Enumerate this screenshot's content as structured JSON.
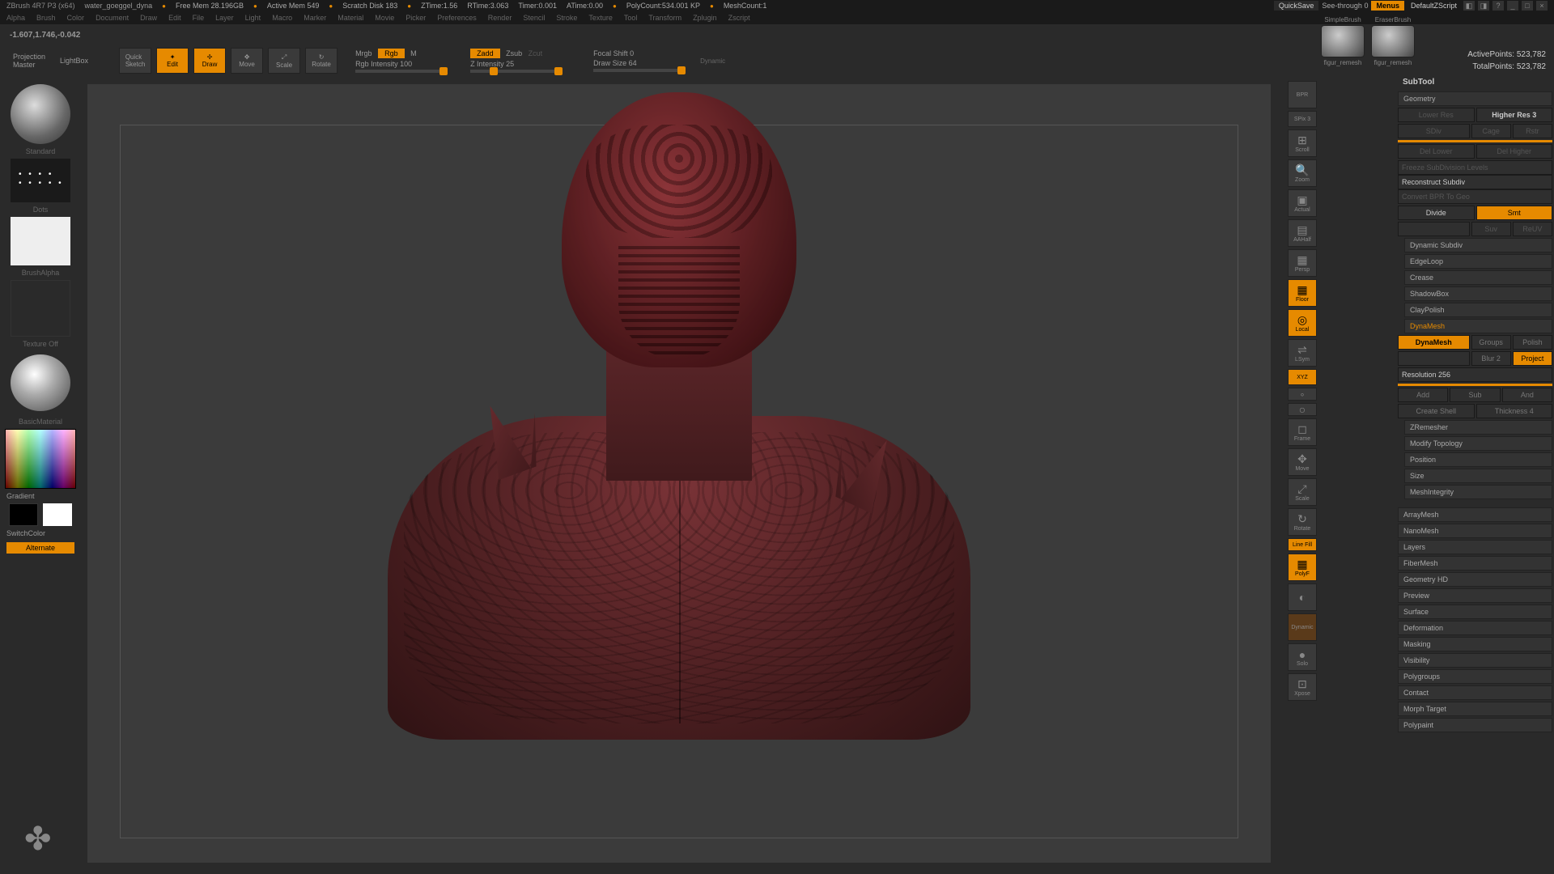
{
  "title": {
    "app": "ZBrush 4R7 P3 (x64)",
    "file": "water_goeggel_dyna",
    "free_mem": "Free Mem 28.196GB",
    "active_mem": "Active Mem 549",
    "scratch": "Scratch Disk 183",
    "ztime": "ZTime:1.56",
    "rtime": "RTime:3.063",
    "timer": "Timer:0.001",
    "atime": "ATime:0.00",
    "polycount": "PolyCount:534.001 KP",
    "meshcount": "MeshCount:1",
    "quicksave": "QuickSave",
    "seethrough": "See-through   0",
    "menus": "Menus",
    "dscript": "DefaultZScript"
  },
  "menubar": [
    "Alpha",
    "Brush",
    "Color",
    "Document",
    "Draw",
    "Edit",
    "File",
    "Layer",
    "Light",
    "Macro",
    "Marker",
    "Material",
    "Movie",
    "Picker",
    "Preferences",
    "Render",
    "Stencil",
    "Stroke",
    "Texture",
    "Tool",
    "Transform",
    "Zplugin",
    "Zscript"
  ],
  "coords": "-1.607,1.746,-0.042",
  "toolbar": {
    "projection": "Projection\nMaster",
    "lightbox": "LightBox",
    "quicksketch": "Quick\nSketch",
    "edit": "Edit",
    "draw": "Draw",
    "move": "Move",
    "scale": "Scale",
    "rotate": "Rotate",
    "mrgb": "Mrgb",
    "rgb": "Rgb",
    "m": "M",
    "rgb_intensity": "Rgb Intensity 100",
    "zadd": "Zadd",
    "zsub": "Zsub",
    "zcut": "Zcut",
    "z_intensity": "Z Intensity 25",
    "focal": "Focal Shift 0",
    "draw_size": "Draw Size 64",
    "dynamic": "Dynamic",
    "active_pts": "ActivePoints: 523,782",
    "total_pts": "TotalPoints: 523,782"
  },
  "left": {
    "brush": "Standard",
    "stroke": "Dots",
    "alpha": "BrushAlpha",
    "texture": "Texture Off",
    "material": "BasicMaterial",
    "gradient": "Gradient",
    "switch": "SwitchColor",
    "alternate": "Alternate"
  },
  "nav": [
    "BPR",
    "SPix 3",
    "Scroll",
    "Zoom",
    "Actual",
    "AAHalf",
    "Persp",
    "Floor",
    "Local",
    "LSym",
    "XYZ",
    "",
    "",
    "Frame",
    "Move",
    "Scale",
    "Rotate",
    "Line Fill",
    "PolyF",
    "",
    "Dynamic",
    "Solo",
    "Xpose"
  ],
  "shelf": {
    "b1": "SimpleBrush",
    "b2": "EraserBrush",
    "t1": "figur_remesh",
    "t2": "figur_remesh"
  },
  "right": {
    "subtool": "SubTool",
    "geometry": "Geometry",
    "lower_res": "Lower Res",
    "higher_res": "Higher Res 3",
    "sdiv": "SDiv",
    "cage": "Cage",
    "rstr": "Rstr",
    "del_lower": "Del Lower",
    "del_higher": "Del Higher",
    "freeze": "Freeze SubDivision Levels",
    "reconstruct": "Reconstruct Subdiv",
    "convert": "Convert BPR To Geo",
    "divide": "Divide",
    "smt": "Smt",
    "suv": "Suv",
    "reuv": "ReUV",
    "dynamic_subdiv": "Dynamic Subdiv",
    "edgeloop": "EdgeLoop",
    "crease": "Crease",
    "shadowbox": "ShadowBox",
    "claypolish": "ClayPolish",
    "dynamesh_h": "DynaMesh",
    "dynamesh": "DynaMesh",
    "groups": "Groups",
    "polish": "Polish",
    "blur": "Blur 2",
    "project": "Project",
    "resolution": "Resolution 256",
    "add": "Add",
    "sub": "Sub",
    "and": "And",
    "create_shell": "Create Shell",
    "thickness": "Thickness 4",
    "zremesher": "ZRemesher",
    "modify_topo": "Modify Topology",
    "position": "Position",
    "size": "Size",
    "meshintegrity": "MeshIntegrity",
    "arraymesh": "ArrayMesh",
    "nanomesh": "NanoMesh",
    "layers": "Layers",
    "fibermesh": "FiberMesh",
    "geohd": "Geometry HD",
    "preview": "Preview",
    "surface": "Surface",
    "deformation": "Deformation",
    "masking": "Masking",
    "visibility": "Visibility",
    "polygroups": "Polygroups",
    "contact": "Contact",
    "morph": "Morph Target",
    "polypaint": "Polypaint"
  }
}
